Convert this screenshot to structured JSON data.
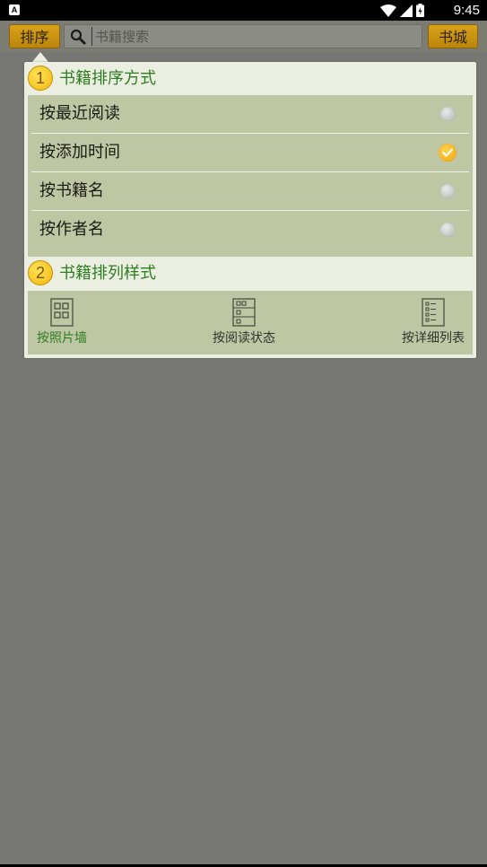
{
  "status_bar": {
    "app_badge": "A",
    "time": "9:45",
    "icons": [
      "wifi-icon",
      "signal-icon",
      "battery-icon"
    ]
  },
  "toolbar": {
    "sort_label": "排序",
    "search_placeholder": "书籍搜索",
    "search_value": "",
    "store_label": "书城"
  },
  "popup": {
    "sort_section": {
      "number": "1",
      "title": "书籍排序方式",
      "options": [
        {
          "label": "按最近阅读",
          "selected": false
        },
        {
          "label": "按添加时间",
          "selected": true
        },
        {
          "label": "按书籍名",
          "selected": false
        },
        {
          "label": "按作者名",
          "selected": false
        }
      ]
    },
    "style_section": {
      "number": "2",
      "title": "书籍排列样式",
      "options": [
        {
          "label": "按照片墙",
          "icon": "photo-wall-icon",
          "active": true
        },
        {
          "label": "按阅读状态",
          "icon": "reading-status-icon",
          "active": false
        },
        {
          "label": "按详细列表",
          "icon": "detail-list-icon",
          "active": false
        }
      ]
    }
  },
  "colors": {
    "accent_orange": "#d8a21a",
    "section_title_green": "#2e7d22",
    "list_bg": "#bfc6a4",
    "overlay_bg": "#777773"
  }
}
